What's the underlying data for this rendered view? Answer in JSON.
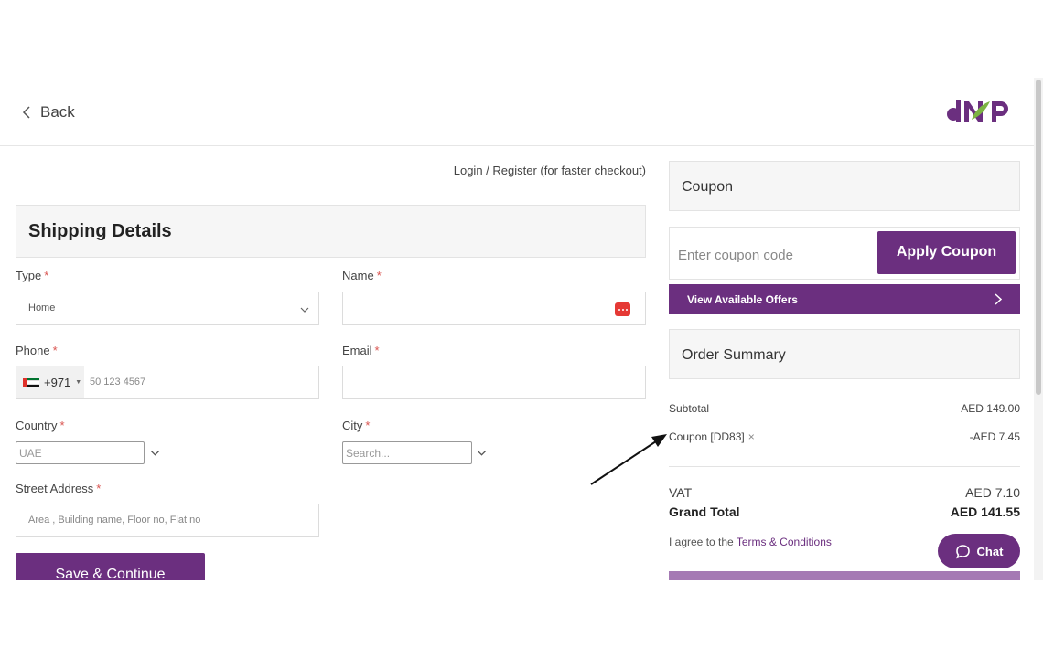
{
  "header": {
    "back_label": "Back",
    "logo_alt": "dNP logo"
  },
  "login_link": "Login / Register (for faster checkout)",
  "shipping": {
    "title": "Shipping Details",
    "type": {
      "label": "Type",
      "value": "Home"
    },
    "name": {
      "label": "Name",
      "value": ""
    },
    "phone": {
      "label": "Phone",
      "country_code": "+971",
      "placeholder": "50 123 4567"
    },
    "email": {
      "label": "Email",
      "value": ""
    },
    "country": {
      "label": "Country",
      "placeholder": "UAE"
    },
    "city": {
      "label": "City",
      "placeholder": "Search..."
    },
    "street": {
      "label": "Street Address",
      "placeholder": "Area , Building name, Floor no, Flat no"
    },
    "required_mark": "*",
    "save_label": "Save & Continue"
  },
  "coupon": {
    "title": "Coupon",
    "placeholder": "Enter coupon code",
    "apply_label": "Apply Coupon",
    "offers_label": "View Available Offers"
  },
  "summary": {
    "title": "Order Summary",
    "subtotal_label": "Subtotal",
    "subtotal_value": "AED 149.00",
    "coupon_label": "Coupon [DD83]",
    "coupon_remove": "×",
    "coupon_value": "-AED 7.45",
    "vat_label": "VAT",
    "vat_value": "AED 7.10",
    "grand_label": "Grand Total",
    "grand_value": "AED 141.55",
    "terms_prefix": "I agree to the ",
    "terms_link": "Terms & Conditions"
  },
  "chat_label": "Chat",
  "colors": {
    "brand": "#6b2f7f",
    "required": "#d9534f",
    "flag_red": "#e0312b",
    "flag_green": "#00732f"
  },
  "icons": [
    "chevron-left-icon",
    "chevron-down-icon",
    "password-manager-icon",
    "chevron-right-icon",
    "chat-bubble-icon",
    "annotation-arrow-icon",
    "uae-flag-icon"
  ]
}
